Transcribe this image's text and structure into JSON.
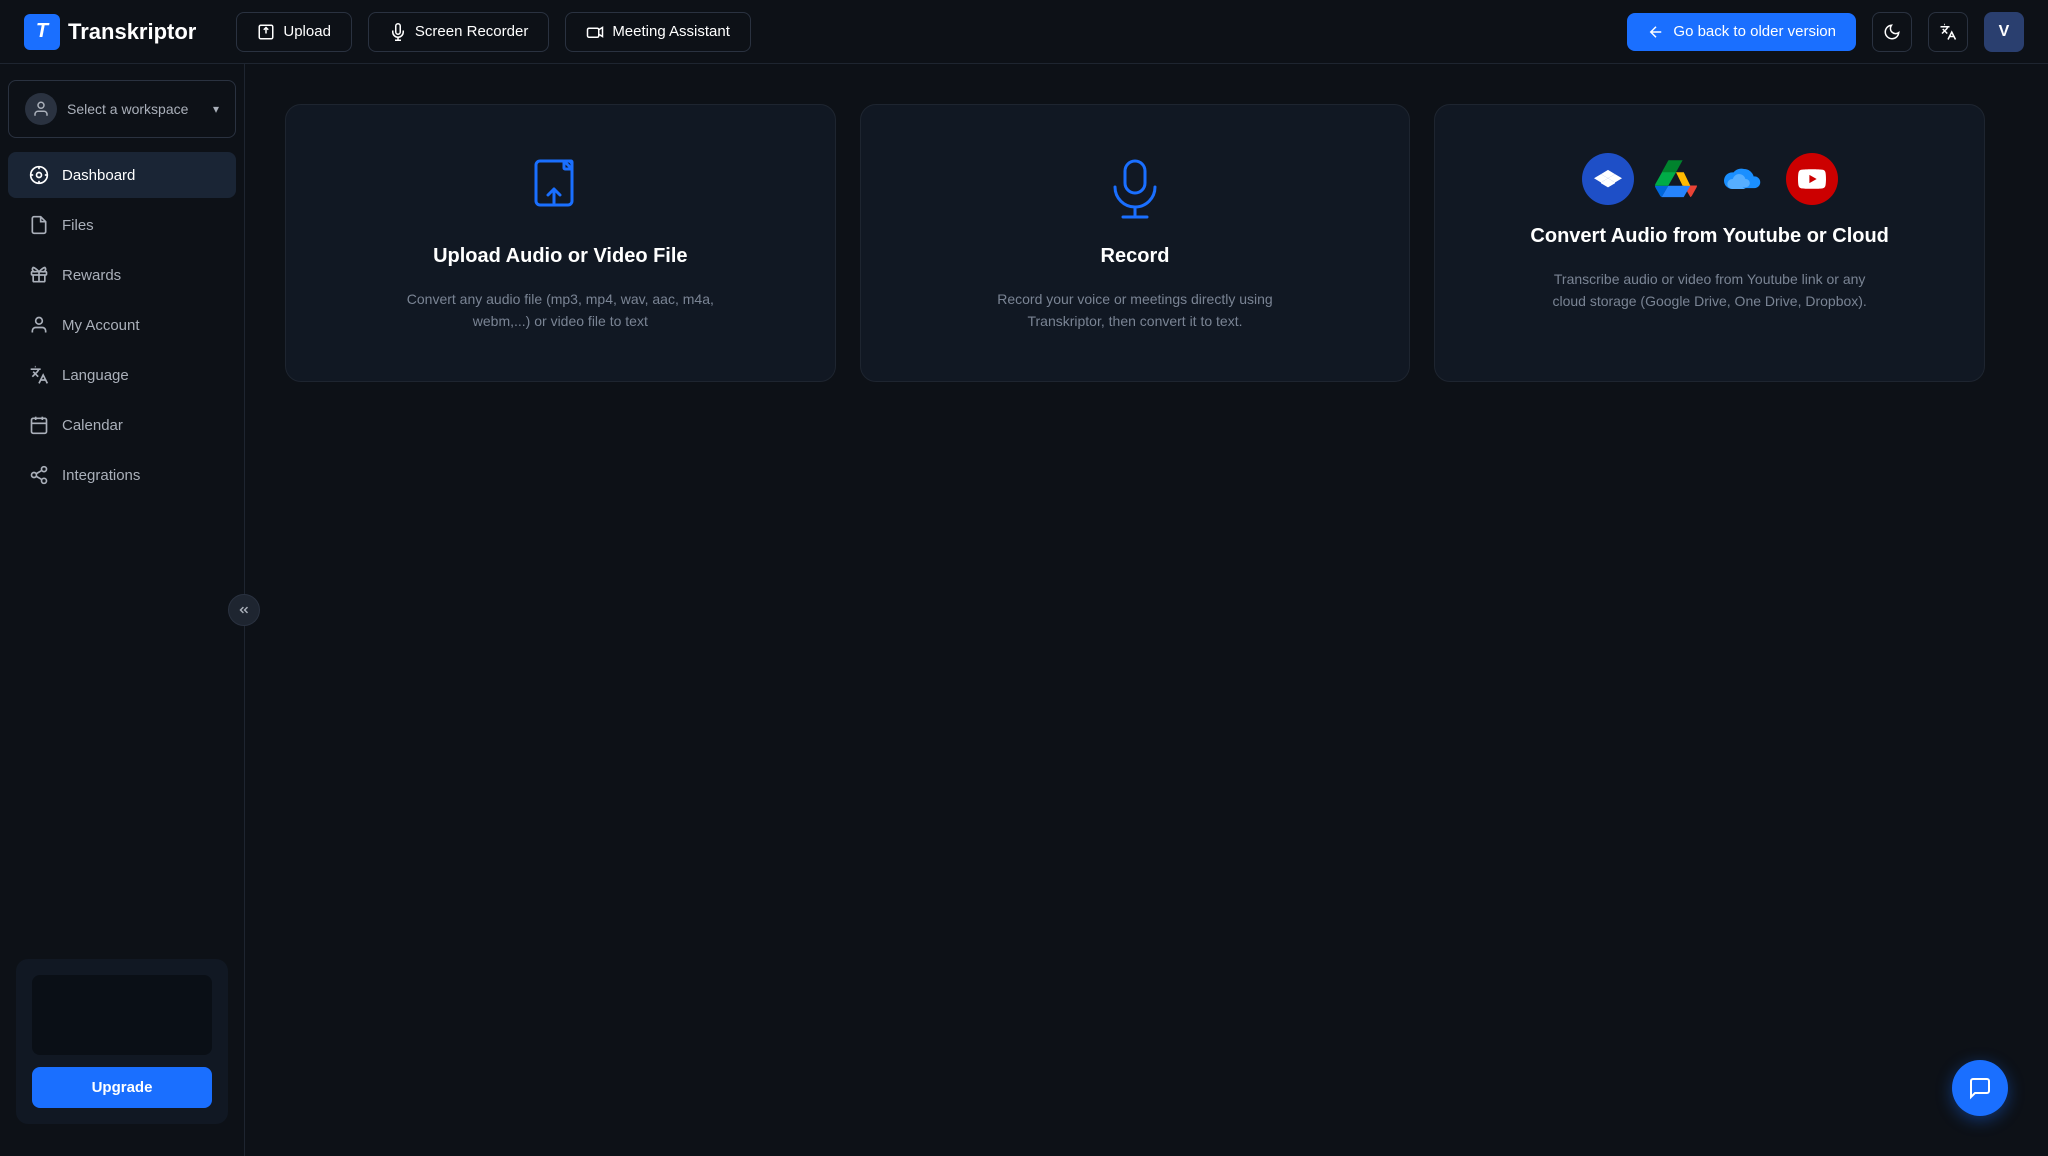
{
  "navbar": {
    "logo_letter": "T",
    "logo_name": "Transkriptor",
    "upload_label": "Upload",
    "screen_recorder_label": "Screen Recorder",
    "meeting_assistant_label": "Meeting Assistant",
    "go_back_label": "Go back to older version",
    "avatar_letter": "V"
  },
  "sidebar": {
    "workspace_label": "Select a workspace",
    "items": [
      {
        "id": "dashboard",
        "label": "Dashboard",
        "active": true
      },
      {
        "id": "files",
        "label": "Files",
        "active": false
      },
      {
        "id": "rewards",
        "label": "Rewards",
        "active": false
      },
      {
        "id": "my-account",
        "label": "My Account",
        "active": false
      },
      {
        "id": "language",
        "label": "Language",
        "active": false
      },
      {
        "id": "calendar",
        "label": "Calendar",
        "active": false
      },
      {
        "id": "integrations",
        "label": "Integrations",
        "active": false
      }
    ],
    "upgrade_button": "Upgrade"
  },
  "cards": [
    {
      "id": "upload",
      "title": "Upload Audio or Video File",
      "description": "Convert any audio file (mp3, mp4, wav, aac, m4a, webm,...) or video file to text"
    },
    {
      "id": "record",
      "title": "Record",
      "description": "Record your voice or meetings directly using Transkriptor, then convert it to text."
    },
    {
      "id": "cloud",
      "title": "Convert Audio from Youtube or Cloud",
      "description": "Transcribe audio or video from Youtube link or any cloud storage (Google Drive, One Drive, Dropbox)."
    }
  ]
}
